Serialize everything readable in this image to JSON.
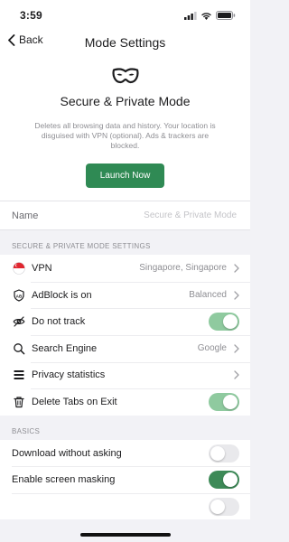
{
  "status": {
    "time": "3:59"
  },
  "nav": {
    "back_label": "Back",
    "title": "Mode Settings"
  },
  "hero": {
    "title": "Secure & Private Mode",
    "description": "Deletes all browsing data and history. Your location is disguised with VPN (optional). Ads & trackers are blocked.",
    "launch_label": "Launch Now",
    "accent": "#2f8a54"
  },
  "name_field": {
    "label": "Name",
    "placeholder": "Secure & Private Mode",
    "value": ""
  },
  "settings": {
    "header": "SECURE & PRIVATE MODE SETTINGS",
    "vpn": {
      "label": "VPN",
      "value": "Singapore, Singapore",
      "icon": "singapore-flag-icon"
    },
    "adblock": {
      "label": "AdBlock is on",
      "value": "Balanced",
      "icon": "adblock-shield-icon"
    },
    "do_not_track": {
      "label": "Do not track",
      "on": true,
      "icon": "eye-slash-icon"
    },
    "search_engine": {
      "label": "Search Engine",
      "value": "Google",
      "icon": "search-icon"
    },
    "privacy_statistics": {
      "label": "Privacy statistics",
      "icon": "statistics-icon"
    },
    "delete_tabs": {
      "label": "Delete Tabs on Exit",
      "on": true,
      "icon": "trash-icon"
    }
  },
  "basics": {
    "header": "BASICS",
    "download_without_asking": {
      "label": "Download without asking",
      "on": false
    },
    "enable_screen_masking": {
      "label": "Enable screen masking",
      "on": true
    }
  }
}
